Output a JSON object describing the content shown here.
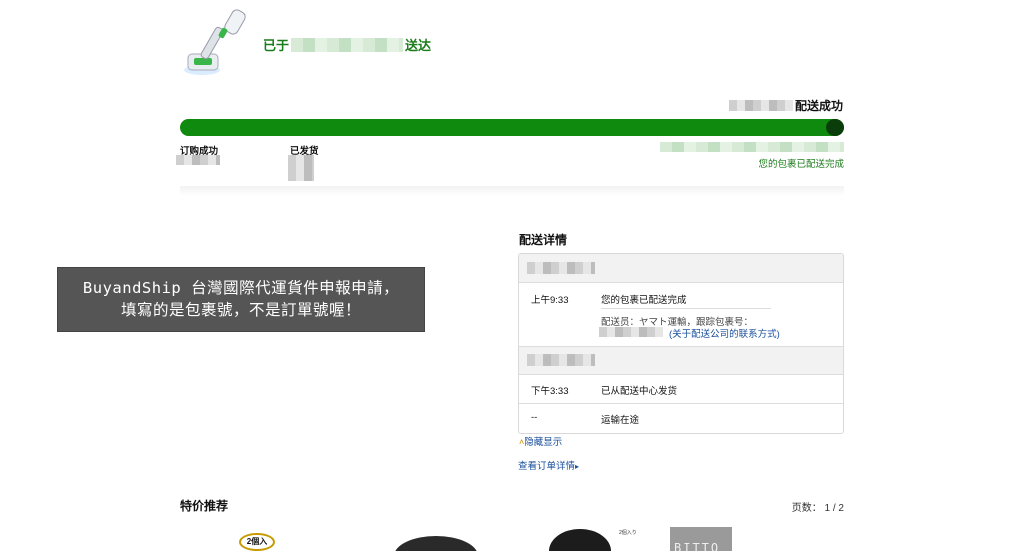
{
  "header": {
    "arrival_prefix": "已于",
    "arrival_suffix": "送达"
  },
  "progress": {
    "delivered_label": "配送成功",
    "fraction": 1.0,
    "steps": [
      {
        "label": "订购成功"
      },
      {
        "label": "已发货"
      },
      {
        "label": "您的包裹已配送完成"
      }
    ]
  },
  "details": {
    "title": "配送详情",
    "events": [
      {
        "time": "上午9:33",
        "desc": "您的包裹已配送完成",
        "courier_label": "配送员：ヤマト運輸，跟踪包裹号：",
        "contact_link": "(关于配送公司的联系方式)"
      },
      {
        "time": "下午3:33",
        "desc": "已从配送中心发货"
      },
      {
        "time": "--",
        "desc": "运输在途"
      }
    ],
    "toggle_label": "隐藏显示",
    "order_link": "查看订单详情"
  },
  "annotation": {
    "line1": "BuyandShip 台灣國際代運貨件申報申請，",
    "line2": "填寫的是包裹號，不是訂單號喔！"
  },
  "recommendations": {
    "title": "特价推荐",
    "page_label": "页数：  1 / 2",
    "badge": "2個入",
    "tag": "2個入り",
    "box_text": "BITTO"
  },
  "colors": {
    "accent": "#0f8a0f",
    "link": "#1a4f9c",
    "annotation_bg": "#555555"
  }
}
